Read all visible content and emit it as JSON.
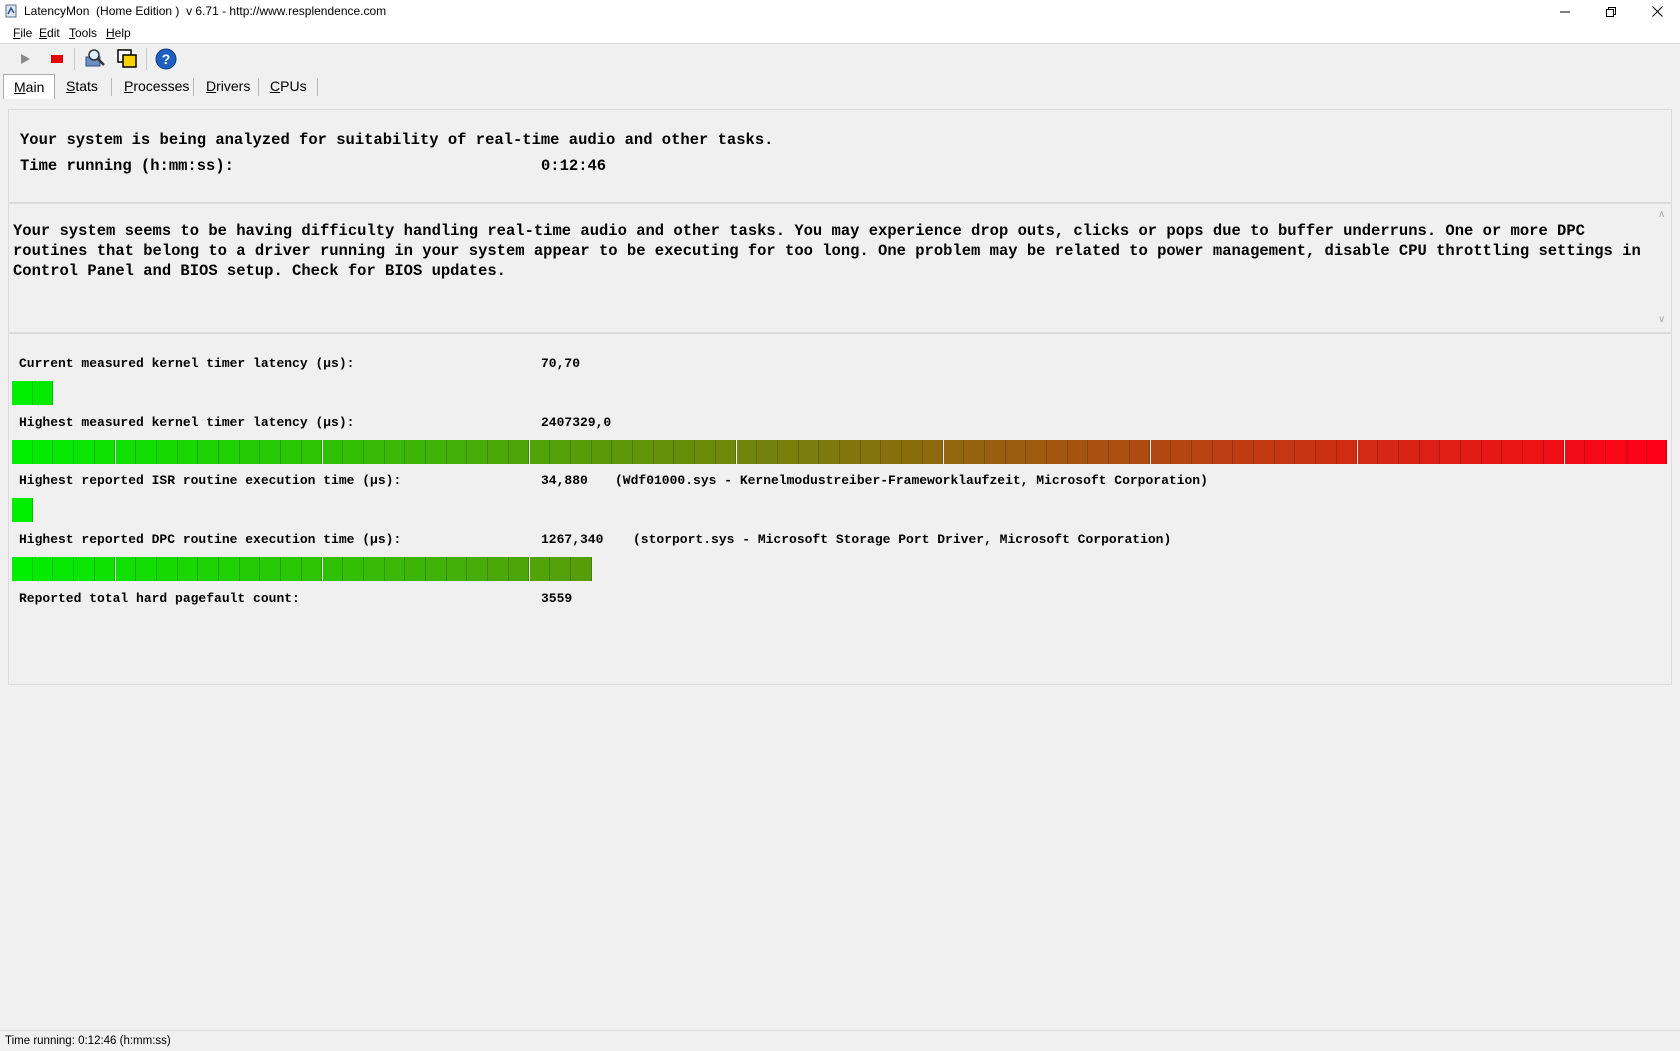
{
  "window": {
    "title": "LatencyMon  (Home Edition )  v 6.71 - http://www.resplendence.com",
    "controls": [
      "minimize-icon",
      "restore-icon",
      "close-icon"
    ]
  },
  "menu": {
    "file": {
      "u": "F",
      "rest": "ile"
    },
    "edit": {
      "u": "E",
      "rest": "dit"
    },
    "tools": {
      "u": "T",
      "rest": "ools"
    },
    "help": {
      "u": "H",
      "rest": "elp"
    }
  },
  "toolbar": {
    "icons": [
      "play-icon",
      "stop-icon",
      "driver-search-icon",
      "windows-icon",
      "help-icon"
    ],
    "colors": {
      "stop": "#e00000",
      "help": "#1e5fbf",
      "play": "#8a8a8a"
    }
  },
  "tabs": {
    "main": {
      "u": "M",
      "rest": "ain"
    },
    "stats": {
      "u": "S",
      "rest": "tats"
    },
    "processes": {
      "u": "P",
      "rest": "rocesses"
    },
    "drivers": {
      "u": "D",
      "rest": "rivers"
    },
    "cpus": {
      "u": "C",
      "rest": "PUs"
    }
  },
  "status_panel": {
    "analysis_text": "Your system is being analyzed for suitability of real-time audio and other tasks.",
    "time_label": "Time running (h:mm:ss):",
    "time_value": "0:12:46"
  },
  "conclusion": {
    "text": "Your system seems to be having difficulty handling real-time audio and other tasks. You may experience drop outs, clicks or pops due to buffer underruns. One or more DPC routines that belong to a driver running in your system appear to be executing for too long. One problem may be related to power management, disable CPU throttling settings in Control Panel and BIOS setup. Check for BIOS updates."
  },
  "measurements": {
    "current_kernel": {
      "label": "Current measured kernel timer latency (µs):",
      "value": "70,70",
      "bar_fraction": 0.024
    },
    "highest_kernel": {
      "label": "Highest measured kernel timer latency (µs):",
      "value": "2407329,0",
      "bar_fraction": 1.0
    },
    "highest_isr": {
      "label": "Highest reported ISR routine execution time (µs):",
      "value": "34,880",
      "detail": "(Wdf01000.sys - Kernelmodustreiber-Frameworklaufzeit, Microsoft Corporation)",
      "bar_fraction": 0.012
    },
    "highest_dpc": {
      "label": "Highest reported DPC routine execution time (µs):",
      "value": "1267,340",
      "detail": "(storport.sys - Microsoft Storage Port Driver, Microsoft Corporation)",
      "bar_fraction": 0.344
    },
    "pagefault": {
      "label": "Reported total hard pagefault count:",
      "value": "3559"
    }
  },
  "bar_colors": {
    "start": "#00ee00",
    "end": "#ff0018"
  },
  "statusbar": {
    "text": "Time running: 0:12:46  (h:mm:ss)"
  }
}
